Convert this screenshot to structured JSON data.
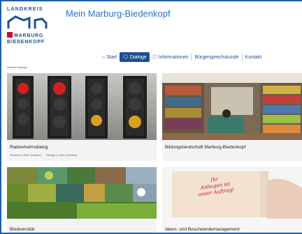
{
  "logo": {
    "top_text": "LANDKREIS",
    "line1": "MARBURG",
    "line2": "BIEDENKOPF"
  },
  "header": {
    "title": "Mein Marburg-Biedenkopf"
  },
  "nav": {
    "items": [
      {
        "label": "Start",
        "icon": "home-icon"
      },
      {
        "label": "Dialoge",
        "icon": "chat-icon",
        "active": true
      },
      {
        "label": "Informationen",
        "icon": "info-icon"
      },
      {
        "label": "Bürgersprechstunde",
        "icon": ""
      },
      {
        "label": "Kontakt",
        "icon": ""
      }
    ]
  },
  "breadcrumb": {
    "text": "Aktuelle Dialoge"
  },
  "cards": [
    {
      "title": "Radverkehrsdialog",
      "meta": [
        "Hinweise in dieser Teilnahme",
        "Beiträge in dieser Teilnahme"
      ]
    },
    {
      "title": "Bildungslandschaft Marburg-Biedenkopf"
    },
    {
      "title": "Biodiversität"
    },
    {
      "title": "Ideen- und Beschwerdemanagement",
      "note_lines": [
        "Ihr",
        "Anliegen ist",
        "unser Auftrag!"
      ]
    }
  ],
  "colors": {
    "brand_blue": "#1d4f91",
    "title_blue": "#2a72c9",
    "logo_red": "#c8102e"
  }
}
